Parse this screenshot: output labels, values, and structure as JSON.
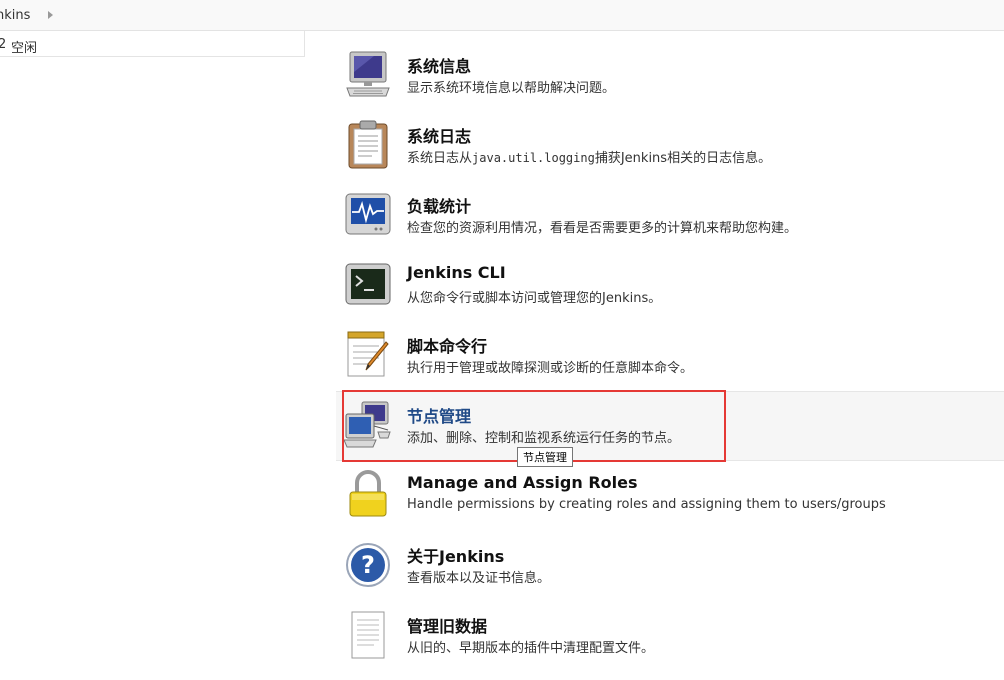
{
  "breadcrumb": {
    "label": "nkins"
  },
  "executor": {
    "number": "2",
    "status": "空闲"
  },
  "items": [
    {
      "title": "系统信息",
      "description": "显示系统环境信息以帮助解决问题。",
      "icon": "computer-icon"
    },
    {
      "title": "系统日志",
      "desc_prefix": "系统日志从",
      "desc_code": "java.util.logging",
      "desc_suffix": "捕获Jenkins相关的日志信息。",
      "icon": "clipboard-log-icon"
    },
    {
      "title": "负载统计",
      "description": "检查您的资源利用情况，看看是否需要更多的计算机来帮助您构建。",
      "icon": "load-monitor-icon"
    },
    {
      "title": "Jenkins CLI",
      "description": "从您命令行或脚本访问或管理您的Jenkins。",
      "icon": "terminal-icon"
    },
    {
      "title": "脚本命令行",
      "description": "执行用于管理或故障探测或诊断的任意脚本命令。",
      "icon": "notepad-pencil-icon"
    },
    {
      "title": "节点管理",
      "description": "添加、删除、控制和监视系统运行任务的节点。",
      "icon": "network-computers-icon"
    },
    {
      "title": "Manage and Assign Roles",
      "description": "Handle permissions by creating roles and assigning them to users/groups",
      "icon": "padlock-icon"
    },
    {
      "title": "关于Jenkins",
      "description": "查看版本以及证书信息。",
      "icon": "help-icon"
    },
    {
      "title": "管理旧数据",
      "description": "从旧的、早期版本的插件中清理配置文件。",
      "icon": "document-icon"
    }
  ],
  "tooltip": {
    "text": "节点管理"
  }
}
